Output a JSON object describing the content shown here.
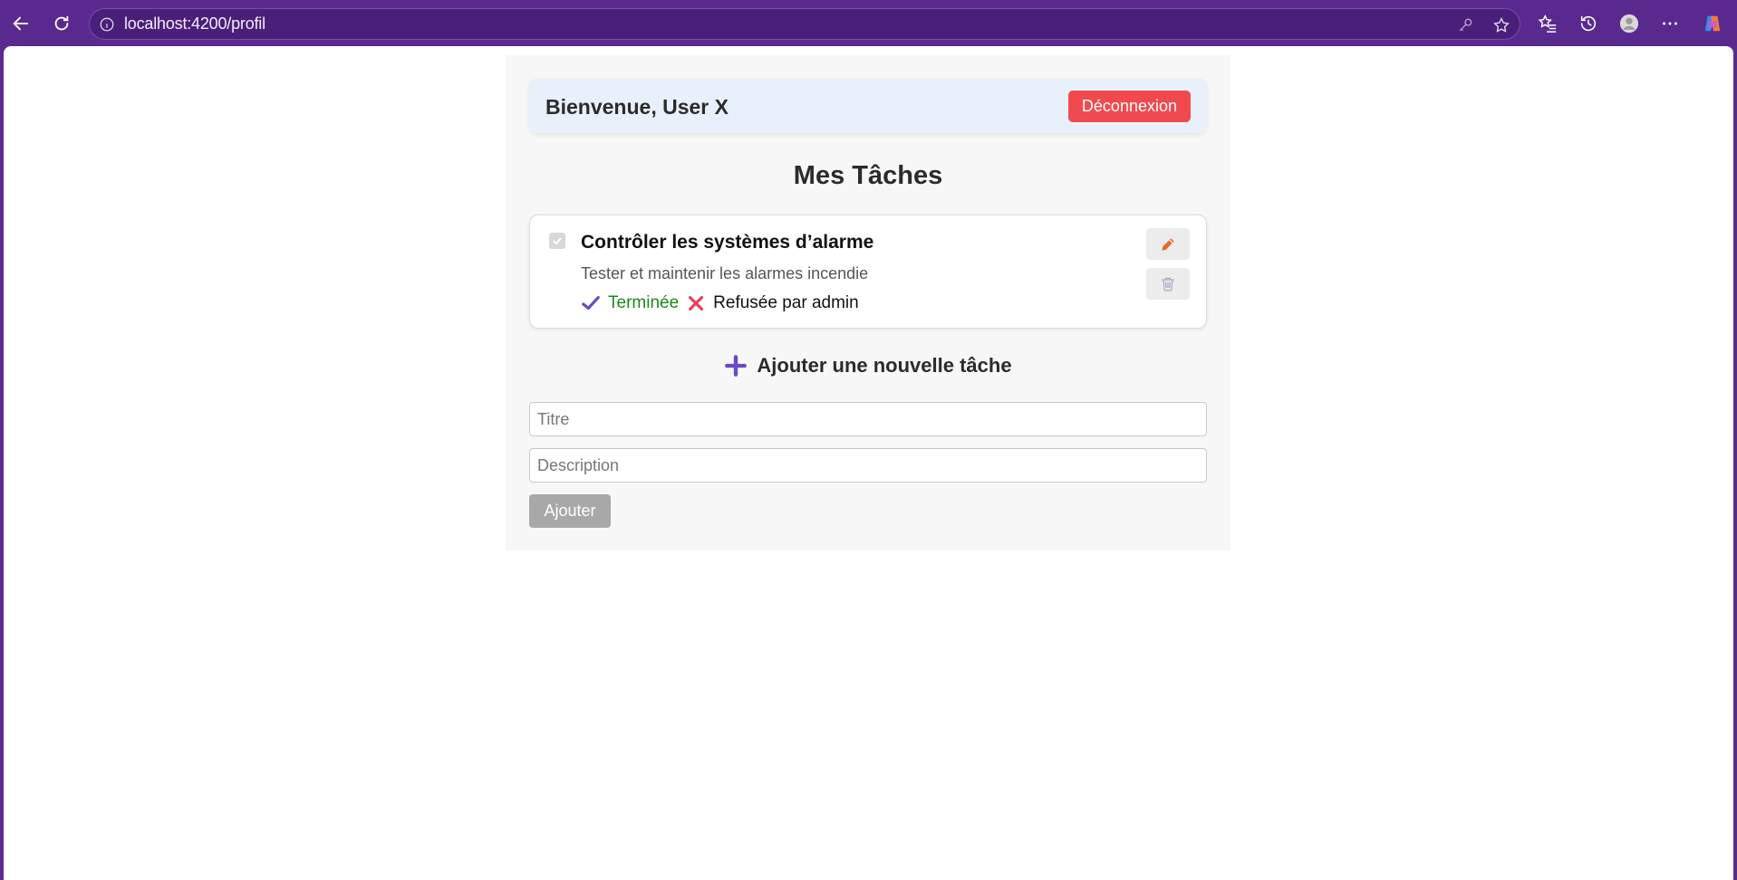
{
  "browser": {
    "url": "localhost:4200/profil"
  },
  "header": {
    "welcome": "Bienvenue, User X",
    "logout_label": "Déconnexion"
  },
  "page_title": "Mes Tâches",
  "tasks": [
    {
      "title": "Contrôler les systèmes d’alarme",
      "description": "Tester et maintenir les alarmes incendie",
      "status_done": "Terminée",
      "status_admin": "Refusée par admin",
      "checked": true
    }
  ],
  "add_form": {
    "heading": "Ajouter une nouvelle tâche",
    "title_placeholder": "Titre",
    "description_placeholder": "Description",
    "submit_label": "Ajouter"
  },
  "colors": {
    "browser_chrome": "#5a2990",
    "logout_button": "#f04a4f",
    "status_done": "#1a8a1a",
    "accent_icon": "#6a4bc4",
    "edit_icon": "#e8672a"
  },
  "icons": [
    "back-icon",
    "refresh-icon",
    "info-icon",
    "key-icon",
    "star-icon",
    "favorites-icon",
    "history-icon",
    "profile-icon",
    "more-icon",
    "copilot-icon",
    "check-icon",
    "cross-icon",
    "pencil-icon",
    "trash-icon",
    "plus-icon"
  ]
}
